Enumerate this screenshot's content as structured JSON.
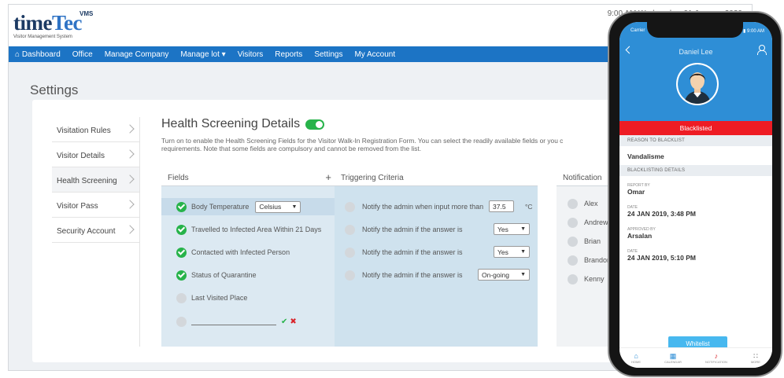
{
  "datetime": "9:00 AM Wednesday, 01 January 2020",
  "logo": {
    "main_a": "time",
    "main_b": "Tec",
    "super": "VMS",
    "tagline": "Visitor Management System"
  },
  "nav": [
    "Dashboard",
    "Office",
    "Manage Company",
    "Manage lot ▾",
    "Visitors",
    "Reports",
    "Settings",
    "My Account"
  ],
  "page_title": "Settings",
  "sidebar": [
    "Visitation Rules",
    "Visitor Details",
    "Health Screening",
    "Visitor Pass",
    "Security Account"
  ],
  "health": {
    "title": "Health Screening Details",
    "desc1": "Turn on to enable the Health Screening Fields for the Visitor Walk-In Registration Form. You can select the readily available fields or you c",
    "desc2": "requirements. Note that some fields are compulsory and cannot be removed from the list."
  },
  "fields": {
    "header": "Fields",
    "plus": "+",
    "items": [
      "Body Temperature",
      "Travelled to Infected Area Within 21 Days",
      "Contacted with Infected Person",
      "Status of Quarantine",
      "Last Visited Place"
    ],
    "unit_select": "Celsius",
    "confirm": "✔",
    "cancel": "✖"
  },
  "criteria": {
    "header": "Triggering Criteria",
    "items": [
      "Notify the admin when input more than",
      "Notify the admin if the answer is",
      "Notify the admin if the answer is",
      "Notify the admin if the answer is"
    ],
    "threshold": "37.5",
    "unit": "°C",
    "answers": [
      "Yes",
      "Yes",
      "On-going"
    ]
  },
  "notification": {
    "header": "Notification",
    "people": [
      "Alex",
      "Andrew",
      "Brian",
      "Brandon",
      "Kenny"
    ]
  },
  "phone": {
    "carrier": "Carrier",
    "status_right": "▮ ▮ 9:00 AM",
    "name": "Daniel Lee",
    "status_bar": "Blacklisted",
    "reason_header": "REASON TO BLACKLIST",
    "reason": "Vandalisme",
    "details_header": "BLACKLISTING DETAILS",
    "details": [
      {
        "label": "REPORT BY",
        "value": "Omar"
      },
      {
        "label": "DATE",
        "value": "24 JAN 2019, 3:48 PM"
      },
      {
        "label": "APPROVED BY",
        "value": "Arsalan"
      },
      {
        "label": "DATE",
        "value": "24 JAN 2019, 5:10 PM"
      }
    ],
    "button": "Whitelist",
    "footer": [
      "HOME",
      "CALENDAR",
      "NOTIFICATION",
      "MORE"
    ]
  }
}
